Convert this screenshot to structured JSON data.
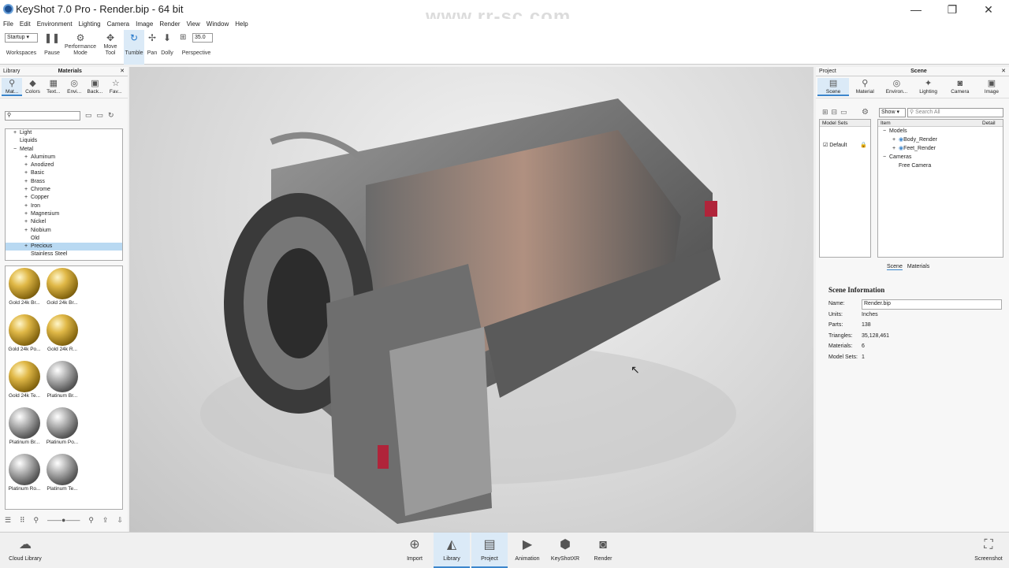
{
  "window": {
    "title": "KeyShot 7.0 Pro  - Render.bip  - 64 bit",
    "watermark": "www.rr-sc.com",
    "minimize": "—",
    "maximize": "❐",
    "close": "✕"
  },
  "menu": [
    "File",
    "Edit",
    "Environment",
    "Lighting",
    "Camera",
    "Image",
    "Render",
    "View",
    "Window",
    "Help"
  ],
  "toolbar": {
    "workspace_value": "Startup",
    "workspaces": "Workspaces",
    "pause": "Pause",
    "performance": "Performance Mode",
    "move_tool": "Move Tool",
    "tumble": "Tumble",
    "pan": "Pan",
    "dolly": "Dolly",
    "fov_value": "35.0",
    "perspective": "Perspective"
  },
  "library": {
    "title": "Library",
    "tab": "Materials",
    "cats": [
      {
        "icon": "⚲",
        "label": "Mat..."
      },
      {
        "icon": "◆",
        "label": "Colors"
      },
      {
        "icon": "▦",
        "label": "Text..."
      },
      {
        "icon": "◎",
        "label": "Envi..."
      },
      {
        "icon": "▣",
        "label": "Back..."
      },
      {
        "icon": "☆",
        "label": "Fav..."
      }
    ],
    "tree": [
      {
        "label": "Light",
        "sym": "+",
        "indent": 1
      },
      {
        "label": "Liquids",
        "sym": "",
        "indent": 1
      },
      {
        "label": "Metal",
        "sym": "−",
        "indent": 1
      },
      {
        "label": "Aluminum",
        "sym": "+",
        "indent": 2
      },
      {
        "label": "Anodized",
        "sym": "+",
        "indent": 2
      },
      {
        "label": "Basic",
        "sym": "+",
        "indent": 2
      },
      {
        "label": "Brass",
        "sym": "+",
        "indent": 2
      },
      {
        "label": "Chrome",
        "sym": "+",
        "indent": 2
      },
      {
        "label": "Copper",
        "sym": "+",
        "indent": 2
      },
      {
        "label": "Iron",
        "sym": "+",
        "indent": 2
      },
      {
        "label": "Magnesium",
        "sym": "+",
        "indent": 2
      },
      {
        "label": "Nickel",
        "sym": "+",
        "indent": 2
      },
      {
        "label": "Niobium",
        "sym": "+",
        "indent": 2
      },
      {
        "label": "Old",
        "sym": "",
        "indent": 2
      },
      {
        "label": "Precious",
        "sym": "+",
        "indent": 2,
        "selected": true
      },
      {
        "label": "Stainless Steel",
        "sym": "",
        "indent": 2
      }
    ],
    "thumbs": [
      {
        "label": "Gold 24k Br...",
        "mat": "gold"
      },
      {
        "label": "Gold 24k Br...",
        "mat": "gold"
      },
      {
        "label": "Gold 24k Po...",
        "mat": "gold"
      },
      {
        "label": "Gold 24k R...",
        "mat": "gold"
      },
      {
        "label": "Gold 24k Te...",
        "mat": "gold"
      },
      {
        "label": "Platinum Br...",
        "mat": "plat"
      },
      {
        "label": "Platinum Br...",
        "mat": "plat"
      },
      {
        "label": "Platinum Po...",
        "mat": "plat"
      },
      {
        "label": "Platinum Ro...",
        "mat": "plat"
      },
      {
        "label": "Platinum Te...",
        "mat": "plat"
      }
    ]
  },
  "project": {
    "title": "Project",
    "tab": "Scene",
    "cats": [
      {
        "icon": "▤",
        "label": "Scene"
      },
      {
        "icon": "⚲",
        "label": "Material"
      },
      {
        "icon": "◎",
        "label": "Environ..."
      },
      {
        "icon": "✦",
        "label": "Lighting"
      },
      {
        "icon": "◙",
        "label": "Camera"
      },
      {
        "icon": "▣",
        "label": "Image"
      }
    ],
    "show": "Show ▾",
    "search_placeholder": "Search All",
    "model_sets_header": "Model Sets",
    "default_set": "Default",
    "item_header": "Item",
    "detail_header": "Detail",
    "items": [
      {
        "label": "Models",
        "sym": "−"
      },
      {
        "label": "Body_Render",
        "sym": "+"
      },
      {
        "label": "Feet_Render",
        "sym": "+"
      },
      {
        "label": "Cameras",
        "sym": "−"
      },
      {
        "label": "Free Camera",
        "sym": ""
      }
    ],
    "subtabs": [
      "Scene",
      "Materials"
    ],
    "info_title": "Scene Information",
    "info": [
      {
        "k": "Name:",
        "v": "Render.bip"
      },
      {
        "k": "Units:",
        "v": "Inches"
      },
      {
        "k": "Parts:",
        "v": "138"
      },
      {
        "k": "Triangles:",
        "v": "35,128,461"
      },
      {
        "k": "Materials:",
        "v": "6"
      },
      {
        "k": "Model Sets:",
        "v": "1"
      }
    ]
  },
  "bottom": {
    "cloud": "Cloud Library",
    "import": "Import",
    "library": "Library",
    "project": "Project",
    "animation": "Animation",
    "keyshotxr": "KeyShotXR",
    "render": "Render",
    "screenshot": "Screenshot"
  },
  "colors": {
    "accent": "#3c86cc",
    "selected": "#b9d9f2"
  }
}
